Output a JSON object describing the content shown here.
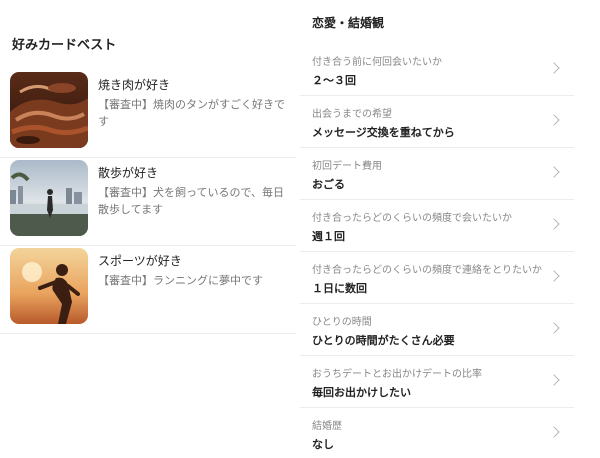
{
  "favorites": {
    "title": "好みカードベスト",
    "cards": [
      {
        "name": "焼き肉が好き",
        "desc": "【審査中】焼肉のタンがすごく好きです",
        "image": "grilled-meat-photo"
      },
      {
        "name": "散歩が好き",
        "desc": "【審査中】犬を飼っているので、毎日散歩してます",
        "image": "walking-dog-photo"
      },
      {
        "name": "スポーツが好き",
        "desc": "【審査中】ランニングに夢中です",
        "image": "running-silhouette-photo"
      }
    ]
  },
  "profile": {
    "title": "恋愛・結婚観",
    "rows": [
      {
        "q": "付き合う前に何回会いたいか",
        "a": "２〜３回"
      },
      {
        "q": "出会うまでの希望",
        "a": "メッセージ交換を重ねてから"
      },
      {
        "q": "初回デート費用",
        "a": "おごる"
      },
      {
        "q": "付き合ったらどのくらいの頻度で会いたいか",
        "a": "週１回"
      },
      {
        "q": "付き合ったらどのくらいの頻度で連絡をとりたいか",
        "a": "１日に数回"
      },
      {
        "q": "ひとりの時間",
        "a": "ひとりの時間がたくさん必要"
      },
      {
        "q": "おうちデートとお出かけデートの比率",
        "a": "毎回お出かけしたい"
      },
      {
        "q": "結婚歴",
        "a": "なし"
      }
    ]
  },
  "icons": {
    "row_action": "chevron-right-icon"
  }
}
